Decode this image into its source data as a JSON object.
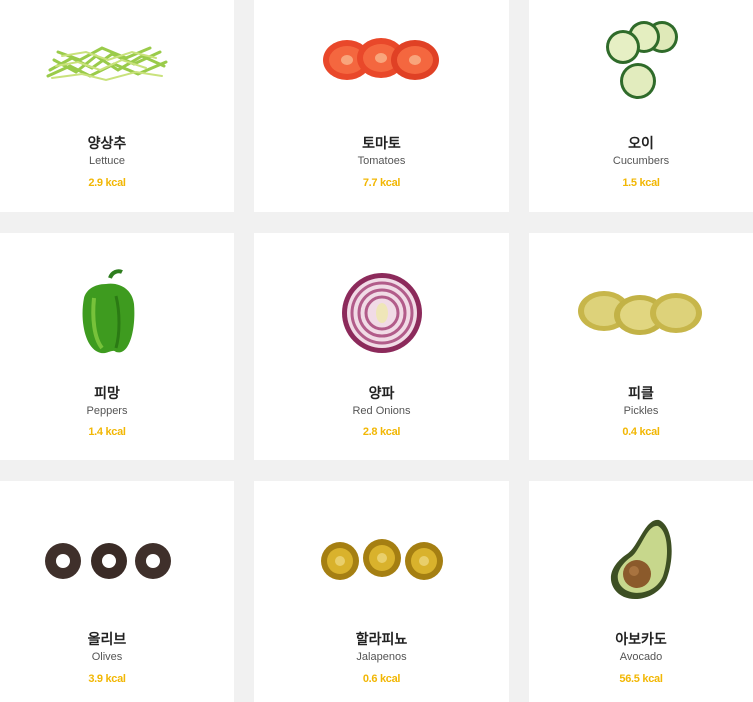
{
  "items": [
    {
      "name_ko": "양상추",
      "name_en": "Lettuce",
      "kcal": "2.9 kcal",
      "icon": "lettuce-icon"
    },
    {
      "name_ko": "토마토",
      "name_en": "Tomatoes",
      "kcal": "7.7 kcal",
      "icon": "tomato-icon"
    },
    {
      "name_ko": "오이",
      "name_en": "Cucumbers",
      "kcal": "1.5 kcal",
      "icon": "cucumber-icon"
    },
    {
      "name_ko": "피망",
      "name_en": "Peppers",
      "kcal": "1.4 kcal",
      "icon": "pepper-icon"
    },
    {
      "name_ko": "양파",
      "name_en": "Red Onions",
      "kcal": "2.8 kcal",
      "icon": "onion-icon"
    },
    {
      "name_ko": "피클",
      "name_en": "Pickles",
      "kcal": "0.4 kcal",
      "icon": "pickle-icon"
    },
    {
      "name_ko": "올리브",
      "name_en": "Olives",
      "kcal": "3.9 kcal",
      "icon": "olive-icon"
    },
    {
      "name_ko": "할라피뇨",
      "name_en": "Jalapenos",
      "kcal": "0.6 kcal",
      "icon": "jalapeno-icon"
    },
    {
      "name_ko": "아보카도",
      "name_en": "Avocado",
      "kcal": "56.5 kcal",
      "icon": "avocado-icon"
    }
  ],
  "colors": {
    "kcal": "#f2b705",
    "background": "#f1f1f1",
    "card": "#ffffff"
  }
}
